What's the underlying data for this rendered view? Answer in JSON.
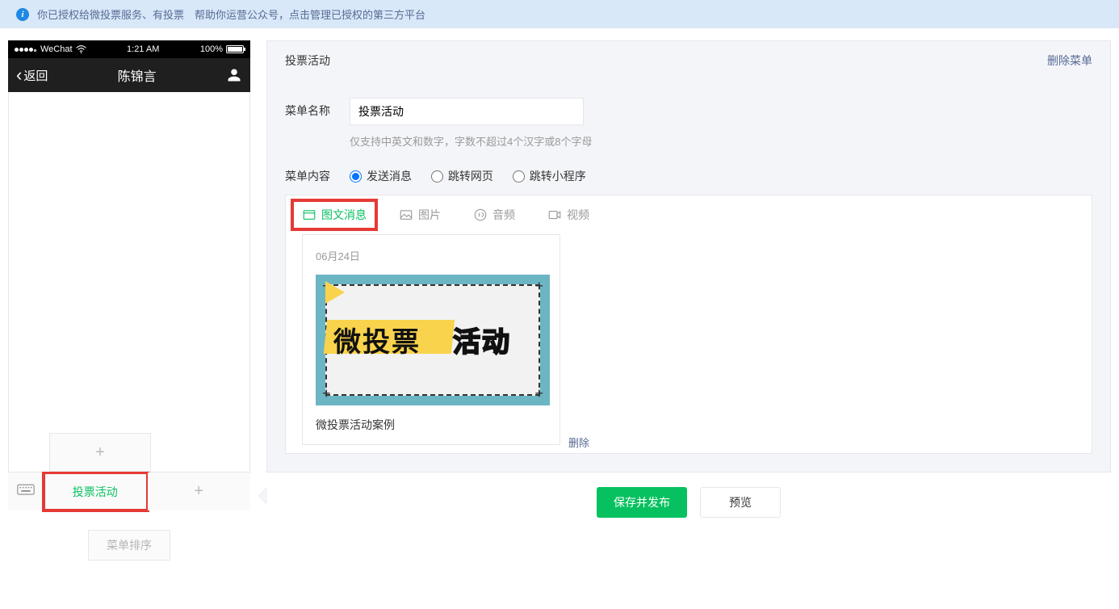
{
  "notice": {
    "prefix": "你已授权给微投票服务、有投票　帮助你运营公众号，点击管理",
    "link_text": "已授权的第三方平台"
  },
  "phone": {
    "carrier": "WeChat",
    "time": "1:21 AM",
    "battery": "100%",
    "back_label": "返回",
    "chat_title": "陈锦言",
    "menu_item_active": "投票活动",
    "sort_button": "菜单排序"
  },
  "panel": {
    "title": "投票活动",
    "delete_menu": "删除菜单",
    "name_label": "菜单名称",
    "name_value": "投票活动",
    "name_hint": "仅支持中英文和数字，字数不超过4个汉字或8个字母",
    "content_label": "菜单内容",
    "radios": {
      "send_message": "发送消息",
      "jump_page": "跳转网页",
      "jump_miniprogram": "跳转小程序"
    },
    "tabs": {
      "article": "图文消息",
      "image": "图片",
      "audio": "音频",
      "video": "视频"
    },
    "article": {
      "date": "06月24日",
      "image_text_left": "微投票",
      "image_text_right": "活动",
      "title": "微投票活动案例",
      "delete": "删除"
    }
  },
  "actions": {
    "save_publish": "保存并发布",
    "preview": "预览"
  }
}
